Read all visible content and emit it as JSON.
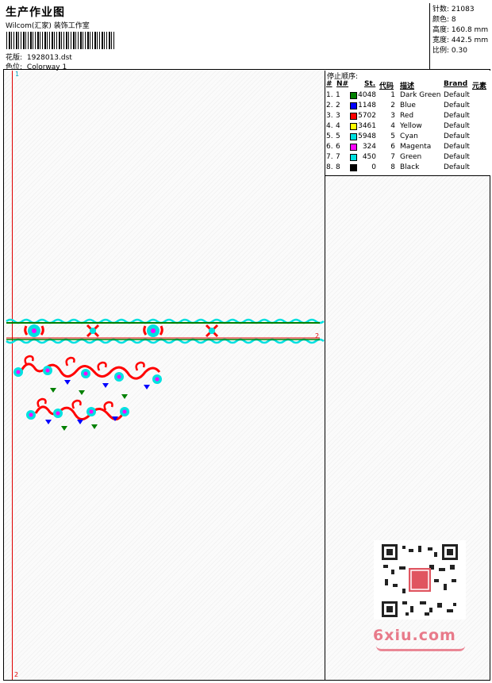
{
  "header": {
    "title": "生产作业图",
    "company": "Wilcom(汇家) 装饰工作室",
    "design_label": "花版:",
    "design_value": "1928013.dst",
    "colorway_label": "色位:",
    "colorway_value": "Colorway 1"
  },
  "stats": [
    {
      "label": "针数:",
      "value": "21083"
    },
    {
      "label": "颜色:",
      "value": "8"
    },
    {
      "label": "高度:",
      "value": "160.8 mm"
    },
    {
      "label": "宽度:",
      "value": "442.5 mm"
    },
    {
      "label": "比例:",
      "value": "0.30"
    }
  ],
  "canvas_marks": {
    "top_left": "1",
    "bottom_left": "2",
    "right": "2"
  },
  "stop_sequence": {
    "title": "停止顺序:",
    "columns": [
      "#",
      "N#",
      "St.",
      "代码",
      "描述",
      "Brand",
      "元素"
    ],
    "rows": [
      {
        "num": "1.",
        "n": "1",
        "color": "#008000",
        "st": "4048",
        "code": "1",
        "desc": "Dark Green",
        "brand": "Default"
      },
      {
        "num": "2.",
        "n": "2",
        "color": "#0000ff",
        "st": "1148",
        "code": "2",
        "desc": "Blue",
        "brand": "Default"
      },
      {
        "num": "3.",
        "n": "3",
        "color": "#ff0000",
        "st": "5702",
        "code": "3",
        "desc": "Red",
        "brand": "Default"
      },
      {
        "num": "4.",
        "n": "4",
        "color": "#ffff00",
        "st": "3461",
        "code": "4",
        "desc": "Yellow",
        "brand": "Default"
      },
      {
        "num": "5.",
        "n": "5",
        "color": "#00e0e0",
        "st": "5948",
        "code": "5",
        "desc": "Cyan",
        "brand": "Default"
      },
      {
        "num": "6.",
        "n": "6",
        "color": "#ff00ff",
        "st": "324",
        "code": "6",
        "desc": "Magenta",
        "brand": "Default"
      },
      {
        "num": "7.",
        "n": "7",
        "color": "#00e0e0",
        "st": "450",
        "code": "7",
        "desc": "Green",
        "brand": "Default"
      },
      {
        "num": "8.",
        "n": "8",
        "color": "#000000",
        "st": "0",
        "code": "8",
        "desc": "Black",
        "brand": "Default"
      }
    ]
  },
  "watermark": {
    "text": "6xiu.com"
  }
}
